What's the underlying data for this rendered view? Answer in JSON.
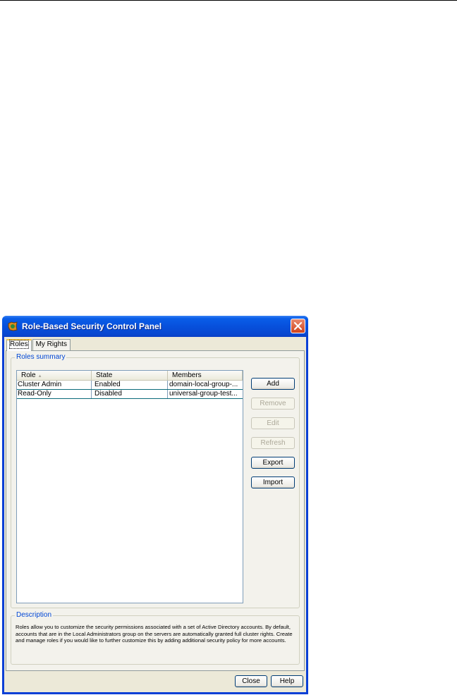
{
  "window": {
    "title": "Role-Based Security Control Panel"
  },
  "tabs": [
    {
      "label": "Roles",
      "active": true
    },
    {
      "label": "My Rights",
      "active": false
    }
  ],
  "roles_summary": {
    "label": "Roles summary",
    "columns": [
      "Role",
      "State",
      "Members"
    ],
    "rows": [
      {
        "role": "Cluster Admin",
        "state": "Enabled",
        "members": "domain-local-group-..."
      },
      {
        "role": "Read-Only",
        "state": "Disabled",
        "members": "universal-group-test..."
      }
    ]
  },
  "buttons": {
    "add": "Add",
    "remove": "Remove",
    "edit": "Edit",
    "refresh": "Refresh",
    "export": "Export",
    "import": "Import"
  },
  "description": {
    "label": "Description",
    "text": "Roles allow you to customize the security permissions associated with a set of Active Directory accounts.  By default, accounts that are in the Local Administrators group on the servers are automatically granted full cluster rights.  Create and manage roles if you would like to further customize this by adding additional security policy for more accounts."
  },
  "footer": {
    "close": "Close",
    "help": "Help"
  },
  "icons": {
    "app": "app-icon",
    "close": "close-icon",
    "sort": "sort-ascending-icon"
  },
  "colors": {
    "titlebar": "#0a5ee8",
    "close_button": "#d0421b",
    "group_label": "#0046d5",
    "row_separator": "#0b6b7b"
  }
}
